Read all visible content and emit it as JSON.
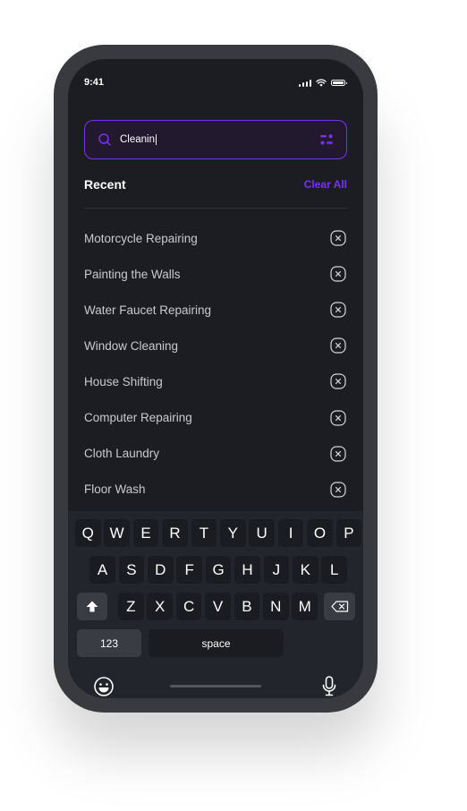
{
  "status": {
    "time": "9:41"
  },
  "search": {
    "value": "Cleanin"
  },
  "recent": {
    "title": "Recent",
    "clear_all": "Clear All",
    "items": [
      "Motorcycle Repairing",
      "Painting the Walls",
      "Water Faucet Repairing",
      "Window Cleaning",
      "House Shifting",
      "Computer Repairing",
      "Cloth Laundry",
      "Floor Wash"
    ]
  },
  "keyboard": {
    "row1": [
      "Q",
      "W",
      "E",
      "R",
      "T",
      "Y",
      "U",
      "I",
      "O",
      "P"
    ],
    "row2": [
      "A",
      "S",
      "D",
      "F",
      "G",
      "H",
      "J",
      "K",
      "L"
    ],
    "row3": [
      "Z",
      "X",
      "C",
      "V",
      "B",
      "N",
      "M"
    ],
    "numbers_label": "123",
    "space_label": "space"
  },
  "colors": {
    "accent": "#7b2ff7",
    "background": "#1c1d23",
    "keyboard": "#23252c"
  }
}
